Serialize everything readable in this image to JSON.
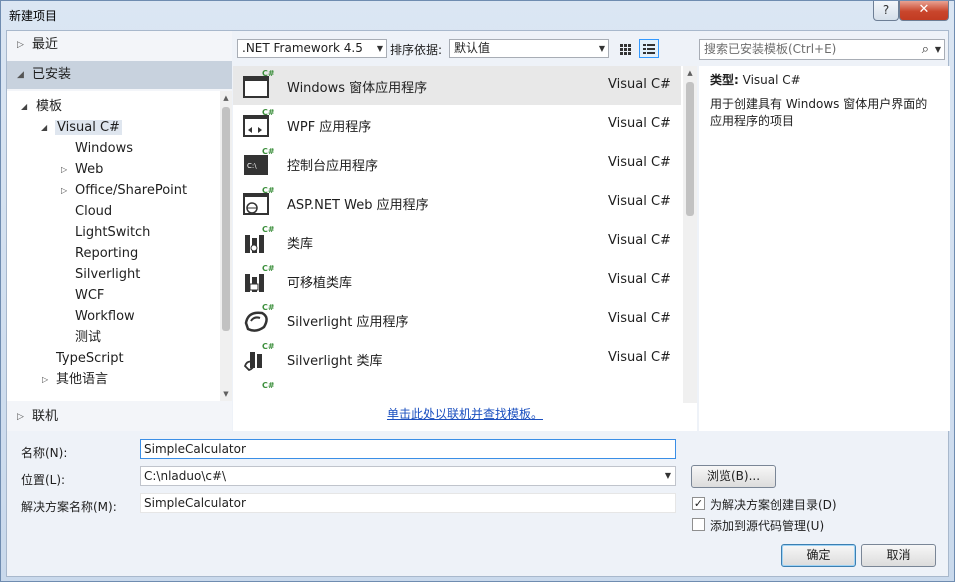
{
  "window": {
    "title": "新建项目",
    "help": "?",
    "close": "✕"
  },
  "left": {
    "recent": "最近",
    "installed": "已安装",
    "online": "联机",
    "tree": {
      "templates": "模板",
      "csharp": "Visual C#",
      "children": [
        "Windows",
        "Web",
        "Office/SharePoint",
        "Cloud",
        "LightSwitch",
        "Reporting",
        "Silverlight",
        "WCF",
        "Workflow",
        "测试"
      ],
      "typescript": "TypeScript",
      "other": "其他语言"
    }
  },
  "toolbar": {
    "framework": ".NET Framework 4.5",
    "sort_label": "排序依据:",
    "sort_value": "默认值"
  },
  "templates": [
    {
      "name": "Windows 窗体应用程序",
      "lang": "Visual C#",
      "icon": "windows-forms-icon"
    },
    {
      "name": "WPF 应用程序",
      "lang": "Visual C#",
      "icon": "wpf-icon"
    },
    {
      "name": "控制台应用程序",
      "lang": "Visual C#",
      "icon": "console-icon"
    },
    {
      "name": "ASP.NET Web 应用程序",
      "lang": "Visual C#",
      "icon": "web-icon"
    },
    {
      "name": "类库",
      "lang": "Visual C#",
      "icon": "class-library-icon"
    },
    {
      "name": "可移植类库",
      "lang": "Visual C#",
      "icon": "portable-library-icon"
    },
    {
      "name": "Silverlight 应用程序",
      "lang": "Visual C#",
      "icon": "silverlight-icon"
    },
    {
      "name": "Silverlight 类库",
      "lang": "Visual C#",
      "icon": "silverlight-library-icon"
    }
  ],
  "online_link": "单击此处以联机并查找模板。",
  "search": {
    "placeholder": "搜索已安装模板(Ctrl+E)"
  },
  "description": {
    "type_label": "类型:",
    "type_value": "Visual C#",
    "text": "用于创建具有 Windows 窗体用户界面的应用程序的项目"
  },
  "form": {
    "name_label": "名称(N):",
    "name_value": "SimpleCalculator",
    "location_label": "位置(L):",
    "location_value": "C:\\nladuo\\c#\\",
    "solution_label": "解决方案名称(M):",
    "solution_value": "SimpleCalculator",
    "browse": "浏览(B)...",
    "create_dir": "为解决方案创建目录(D)",
    "create_dir_checked": true,
    "add_source": "添加到源代码管理(U)",
    "add_source_checked": false,
    "ok": "确定",
    "cancel": "取消"
  },
  "colors": {
    "accent_green": "#3c8f3c",
    "link": "#1a4fbf"
  }
}
